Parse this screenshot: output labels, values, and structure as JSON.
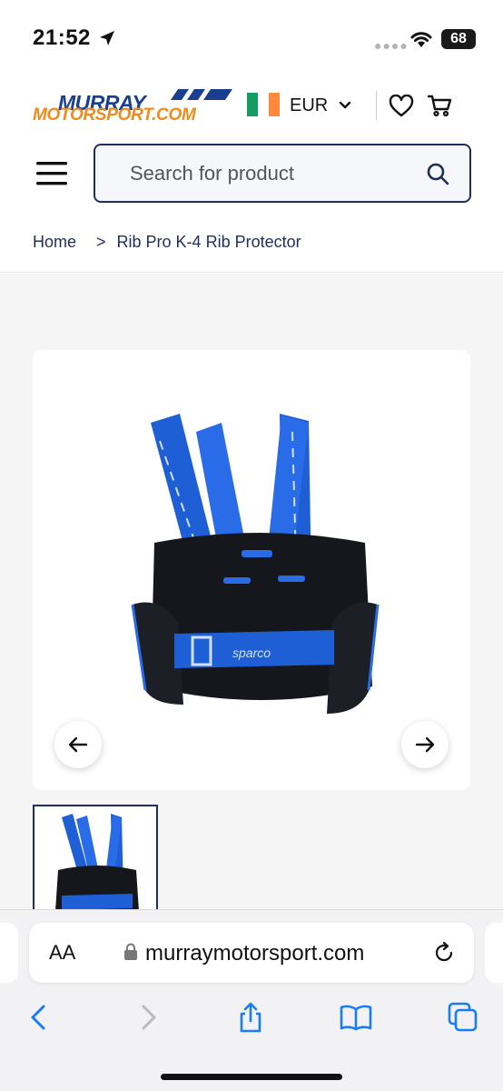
{
  "status": {
    "time": "21:52",
    "battery": "68"
  },
  "header": {
    "logo_line1": "MURRAY",
    "logo_line2": "MOTORSPORT.COM",
    "currency": "EUR",
    "flag_colors": [
      "#169b62",
      "#ffffff",
      "#ff883e"
    ]
  },
  "search": {
    "placeholder": "Search for product"
  },
  "breadcrumb": {
    "home": "Home",
    "separator": ">",
    "current": "Rib Pro K-4 Rib Protector"
  },
  "product": {
    "image_icon": "rib-protector-image",
    "brand_text": "sparco"
  },
  "browser": {
    "aa_label": "AA",
    "url": "murraymotorsport.com"
  },
  "colors": {
    "brand_navy": "#1f2e5a",
    "brand_blue": "#1a3f8f",
    "brand_orange": "#f28a1a",
    "link_blue": "#1a7cf5"
  }
}
